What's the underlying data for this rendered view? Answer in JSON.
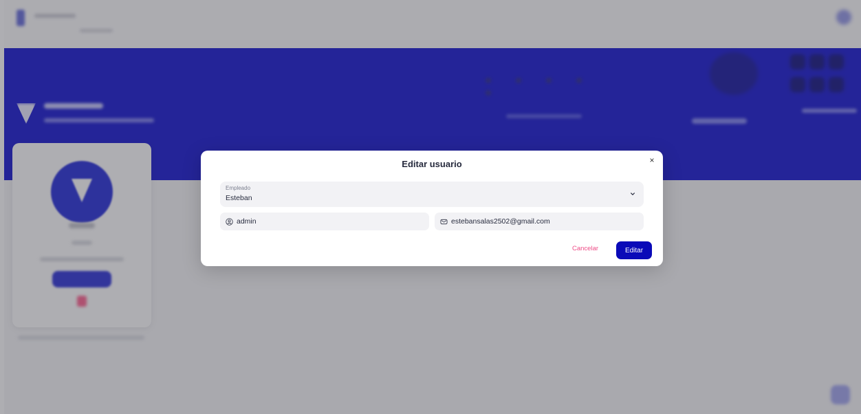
{
  "modal": {
    "title": "Editar usuario",
    "close_symbol": "×",
    "employee_field": {
      "label": "Empleado",
      "value": "Esteban",
      "icon": "chevron-down-icon"
    },
    "username_field": {
      "value": "admin",
      "icon": "user-icon"
    },
    "email_field": {
      "value": "estebansalas2502@gmail.com",
      "icon": "mail-icon"
    },
    "cancel_label": "Cancelar",
    "submit_label": "Editar"
  },
  "colors": {
    "primary": "#0a0ab8",
    "hero": "#0a0ad0",
    "cancel": "#ee4b86",
    "field_bg": "#f2f2f5",
    "overlay": "rgba(70,70,80,0.44)"
  }
}
